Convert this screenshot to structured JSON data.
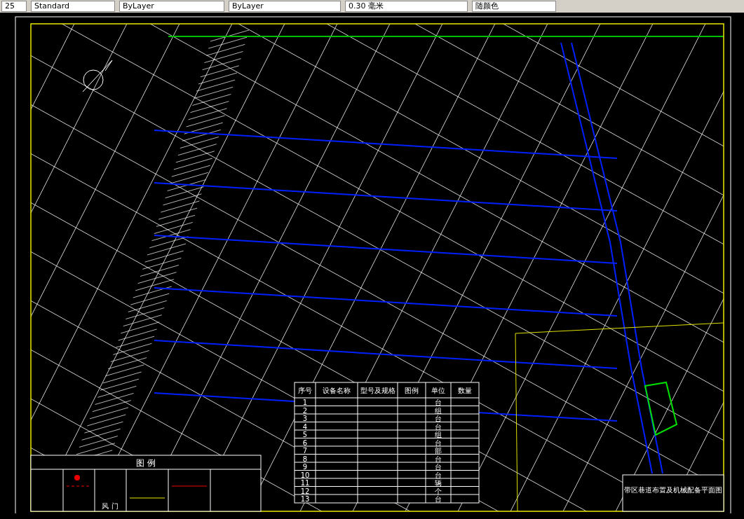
{
  "toolbar": {
    "fields": [
      {
        "value": "25"
      },
      {
        "value": "Standard"
      },
      {
        "value": "ByLayer"
      },
      {
        "value": "ByLayer"
      },
      {
        "value": "0.30 毫米"
      },
      {
        "value": "随颜色"
      }
    ]
  },
  "equipment_table": {
    "columns": [
      "序号",
      "设备名称",
      "型号及规格",
      "图例",
      "单位",
      "数量"
    ],
    "rows": [
      {
        "no": "1",
        "unit": "台"
      },
      {
        "no": "2",
        "unit": "组"
      },
      {
        "no": "3",
        "unit": "台"
      },
      {
        "no": "4",
        "unit": "台"
      },
      {
        "no": "5",
        "unit": "组"
      },
      {
        "no": "6",
        "unit": "台"
      },
      {
        "no": "7",
        "unit": "部"
      },
      {
        "no": "8",
        "unit": "台"
      },
      {
        "no": "9",
        "unit": "台"
      },
      {
        "no": "10",
        "unit": "台"
      },
      {
        "no": "11",
        "unit": "辆"
      },
      {
        "no": "12",
        "unit": "个"
      },
      {
        "no": "13",
        "unit": "台"
      }
    ]
  },
  "legend": {
    "title": "图 例",
    "labels": [
      "风 门"
    ]
  },
  "title_block": {
    "title": "带区巷道布置及机械配备平面图"
  }
}
